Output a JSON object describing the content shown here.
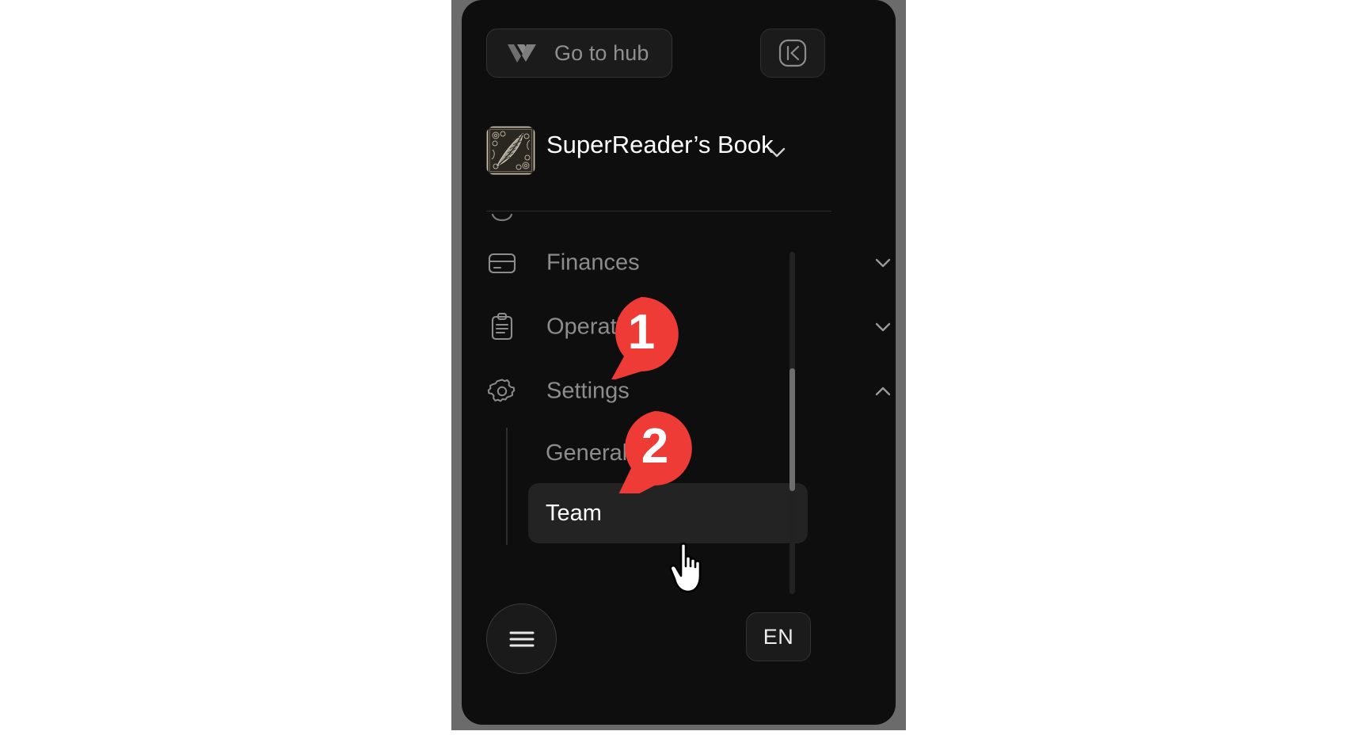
{
  "colors": {
    "page_background": "#ffffff",
    "frame": "#6b6b6b",
    "panel": "#0e0e0e",
    "accent_badge": "#ee3b36",
    "text_muted": "#8c8c8c",
    "text_active": "#ffffff",
    "active_item_background": "#232323"
  },
  "top_bar": {
    "go_to_hub_label": "Go to hub",
    "hub_logo_icon": "w-chevron-logo-icon",
    "collapse_panel_icon": "panel-collapse-left-icon"
  },
  "workspace": {
    "name": "SuperReader’s Book",
    "avatar_icon": "quill-feather-avatar",
    "chevron_icon": "chevron-down-icon"
  },
  "nav": {
    "clipped_item_icon": "partial-icon",
    "items": [
      {
        "label": "Finances",
        "icon": "credit-card-icon",
        "chevron": "chevron-down-icon",
        "expanded": false
      },
      {
        "label": "Operations",
        "icon": "clipboard-icon",
        "chevron": "chevron-down-icon",
        "expanded": false
      },
      {
        "label": "Settings",
        "icon": "gear-icon",
        "chevron": "chevron-up-icon",
        "expanded": true
      }
    ],
    "submenu": [
      {
        "label": "General",
        "active": false
      },
      {
        "label": "Team",
        "active": true
      }
    ],
    "scrollbar": {
      "visible": true
    }
  },
  "bottom_bar": {
    "menu_toggle_icon": "hamburger-menu-icon",
    "language_label": "EN"
  },
  "annotations": [
    {
      "number": "1",
      "target": "Operations"
    },
    {
      "number": "2",
      "target": "Team"
    }
  ],
  "cursor": {
    "type": "pointing-hand-cursor"
  }
}
